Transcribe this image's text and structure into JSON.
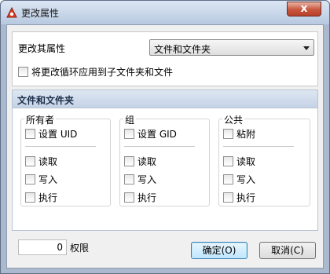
{
  "window": {
    "title": "更改属性",
    "close_label": "x"
  },
  "attributes": {
    "label": "更改其属性",
    "select_value": "文件和文件夹",
    "recursive_label": "将更改循环应用到子文件夹和文件"
  },
  "section": {
    "header": "文件和文件夹",
    "groups": [
      {
        "title": "所有者",
        "special": "设置 UID",
        "read": "读取",
        "write": "写入",
        "exec": "执行"
      },
      {
        "title": "组",
        "special": "设置 GID",
        "read": "读取",
        "write": "写入",
        "exec": "执行"
      },
      {
        "title": "公共",
        "special": "粘附",
        "read": "读取",
        "write": "写入",
        "exec": "执行"
      }
    ]
  },
  "permissions": {
    "value": "0",
    "label": "权限"
  },
  "buttons": {
    "ok": "确定(O)",
    "cancel": "取消(C)"
  }
}
